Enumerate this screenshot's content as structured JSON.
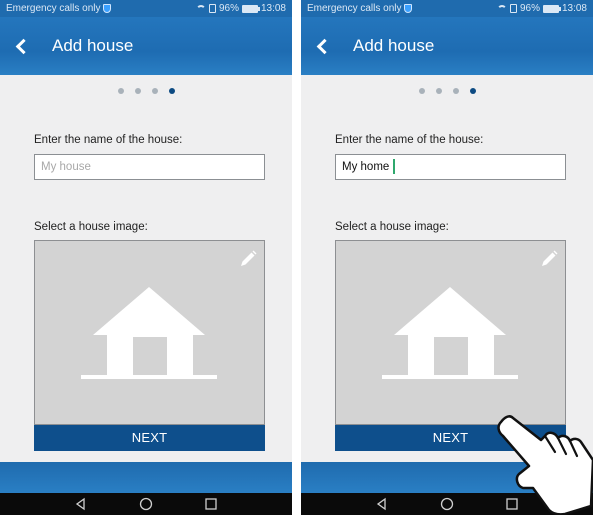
{
  "screens": [
    {
      "status": {
        "left_text": "Emergency calls only",
        "battery": "96%",
        "time": "13:08"
      },
      "header": {
        "title": "Add house"
      },
      "steps": {
        "total": 4,
        "current": 4
      },
      "name_label": "Enter the name of the house:",
      "name_field": {
        "value": "",
        "placeholder": "My house"
      },
      "image_label": "Select a house image:",
      "next_label": "NEXT"
    },
    {
      "status": {
        "left_text": "Emergency calls only",
        "battery": "96%",
        "time": "13:08"
      },
      "header": {
        "title": "Add house"
      },
      "steps": {
        "total": 4,
        "current": 4
      },
      "name_label": "Enter the name of the house:",
      "name_field": {
        "value": "My home",
        "placeholder": "My house"
      },
      "image_label": "Select a house image:",
      "next_label": "NEXT"
    }
  ],
  "icons": {
    "back": "back-arrow-icon",
    "edit": "pencil-icon",
    "house": "house-icon",
    "nav": [
      "back-triangle-icon",
      "home-circle-icon",
      "recents-square-icon"
    ],
    "pointer": "hand-pointer-icon"
  },
  "colors": {
    "app_bar": "#1f6bae",
    "step_active": "#0c4a82",
    "step_inactive": "#a9b2ba",
    "next_button": "#0e4f8c",
    "cursor": "#2fa86d"
  }
}
